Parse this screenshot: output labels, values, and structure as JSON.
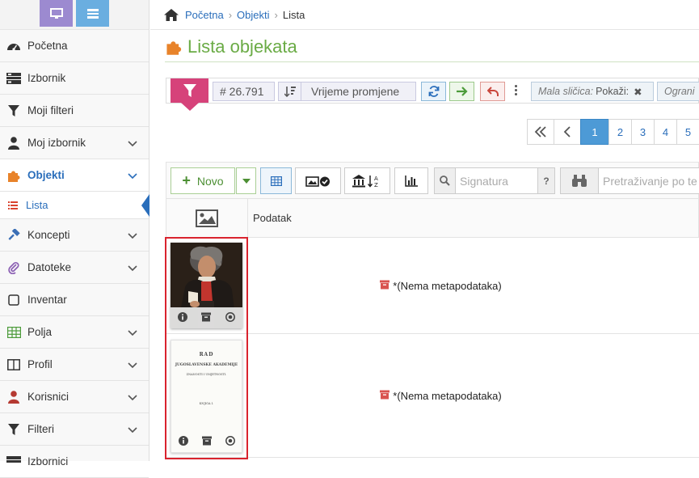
{
  "breadcrumb": {
    "home": "Početna",
    "objects": "Objekti",
    "current": "Lista"
  },
  "page": {
    "title": "Lista objekata"
  },
  "sidebar": {
    "items": [
      {
        "label": "Početna"
      },
      {
        "label": "Izbornik"
      },
      {
        "label": "Moji filteri"
      },
      {
        "label": "Moj izbornik"
      },
      {
        "label": "Objekti"
      },
      {
        "label": "Lista"
      },
      {
        "label": "Koncepti"
      },
      {
        "label": "Datoteke"
      },
      {
        "label": "Inventar"
      },
      {
        "label": "Polja"
      },
      {
        "label": "Profil"
      },
      {
        "label": "Korisnici"
      },
      {
        "label": "Filteri"
      },
      {
        "label": "Izbornici"
      }
    ]
  },
  "filter_bar": {
    "count": "# 26.791",
    "sort_label": "Vrijeme promjene",
    "tag1_key": "Mala sličica:",
    "tag1_value": "Pokaži:",
    "tag2_key": "Ograni"
  },
  "pagination": {
    "pages": [
      "1",
      "2",
      "3",
      "4",
      "5"
    ]
  },
  "toolbar": {
    "new_label": "Novo",
    "signature_placeholder": "Signatura",
    "help_label": "?",
    "search_placeholder": "Pretraživanje po te"
  },
  "table": {
    "header_data": "Podatak",
    "rows": [
      {
        "text": "*(Nema metapodataka)"
      },
      {
        "text": "*(Nema metapodataka)"
      }
    ]
  },
  "doc_thumbnail": {
    "line1": "RAD",
    "line2": "JUGOSLAVENSKE AKADEMIJE",
    "line3": "ZNANOSTI I UMJETNOSTI.",
    "line4": "KNJIGA I."
  },
  "colors": {
    "accent_blue": "#2a6ebb",
    "title_green": "#6aab45",
    "filter_pink": "#d6427a",
    "highlight_red": "#d9232e"
  }
}
